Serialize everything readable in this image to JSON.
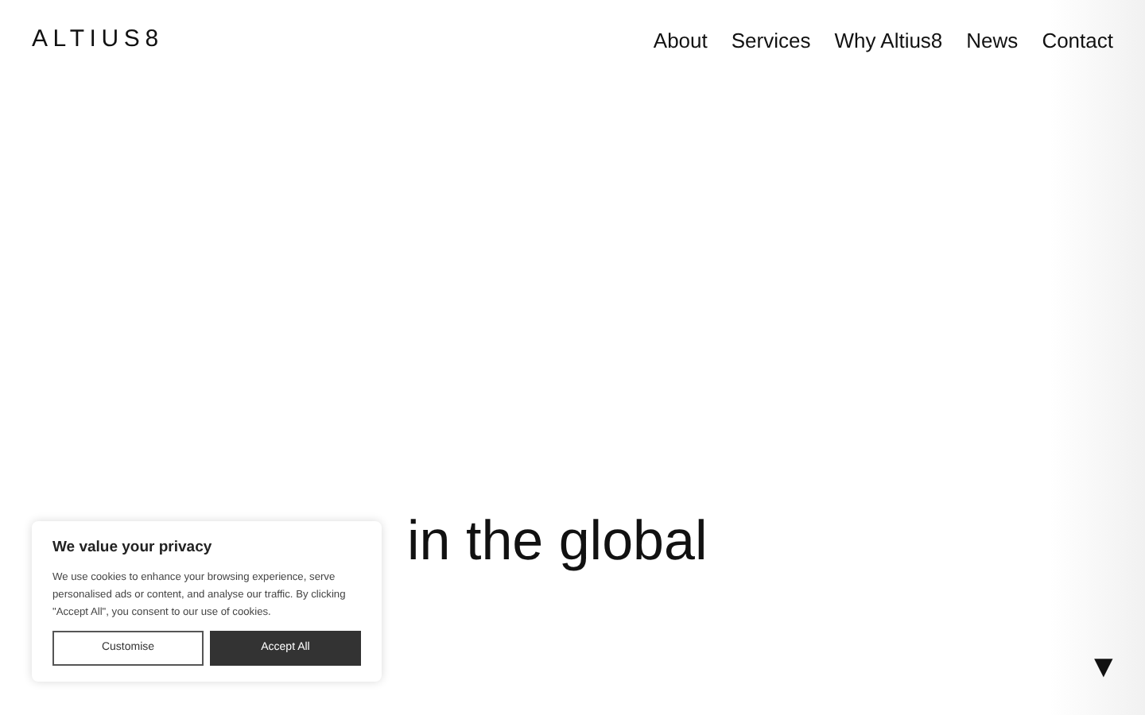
{
  "logo": "ALTIUS8",
  "nav": [
    {
      "label": "About"
    },
    {
      "label": "Services"
    },
    {
      "label": "Why Altius8"
    },
    {
      "label": "News"
    },
    {
      "label": "Contact"
    }
  ],
  "hero": {
    "lines": [
      "in the global"
    ]
  },
  "scroll_arrow": "▼",
  "cookie_banner": {
    "title": "We value your privacy",
    "text": "We use cookies to enhance your browsing experience, serve personalised ads or content, and analyse our traffic. By clicking \"Accept All\", you consent to our use of cookies.",
    "buttons": [
      {
        "label": "Customise",
        "kind": "outline"
      },
      {
        "label": "Accept All",
        "kind": "filled"
      }
    ]
  }
}
